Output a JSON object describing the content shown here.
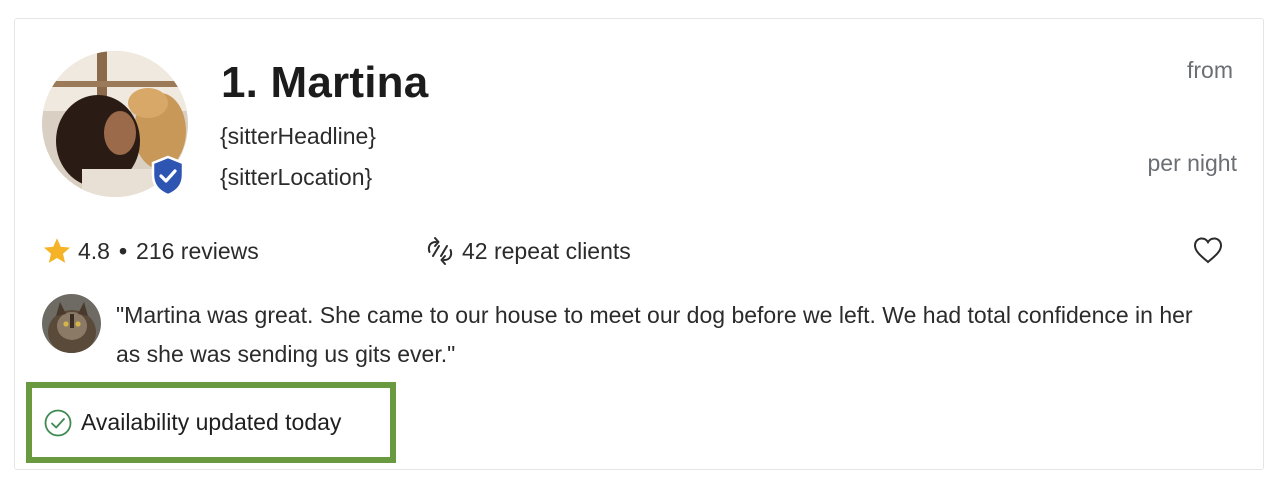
{
  "sitter": {
    "name": "1. Martina",
    "headline": "{sitterHeadline}",
    "location": "{sitterLocation}"
  },
  "price": {
    "from_label": "from",
    "per_night_label": "per night"
  },
  "stats": {
    "rating": "4.8",
    "separator": "•",
    "reviews": "216 reviews",
    "repeat_clients": "42 repeat clients"
  },
  "review": {
    "quote": "\"Martina was great. She came to our house to meet our dog before we left. We had total confidence in her as she was sending us gits ever.\""
  },
  "availability": {
    "label": "Availability updated today"
  },
  "icons": {
    "verified": "shield-check-icon",
    "rating": "star-icon",
    "repeat": "repeat-icon",
    "favorite": "heart-icon",
    "availability": "check-circle-icon"
  },
  "colors": {
    "star": "#f5b427",
    "verified_badge": "#2f55b3",
    "highlight_border": "#6a9a3f",
    "check": "#3f8a52"
  }
}
